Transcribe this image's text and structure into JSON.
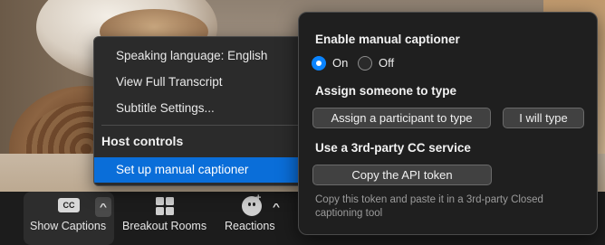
{
  "toolbar": {
    "show_captions_label": "Show Captions",
    "cc_icon_text": "CC",
    "breakout_label": "Breakout Rooms",
    "reactions_label": "Reactions",
    "reactions_plus": "+",
    "caret_up": "^"
  },
  "menu": {
    "items": [
      {
        "label": "Speaking language: English"
      },
      {
        "label": "View Full Transcript"
      },
      {
        "label": "Subtitle Settings..."
      }
    ],
    "host_heading": "Host controls",
    "active_item": "Set up manual captioner"
  },
  "panel": {
    "enable_heading": "Enable manual captioner",
    "on_label": "On",
    "off_label": "Off",
    "assign_heading": "Assign someone to type",
    "assign_participant_button": "Assign a participant to type",
    "i_will_type_button": "I will type",
    "third_party_heading": "Use a 3rd-party CC service",
    "copy_token_button": "Copy the API token",
    "help_text": "Copy this token and paste it in a 3rd-party Closed captioning tool",
    "selected_radio": "On"
  },
  "colors": {
    "accent": "#0a84ff",
    "menu_highlight": "#0a6ed9",
    "panel_bg": "#1f1f1f",
    "toolbar_bg": "#1c1c1c"
  }
}
